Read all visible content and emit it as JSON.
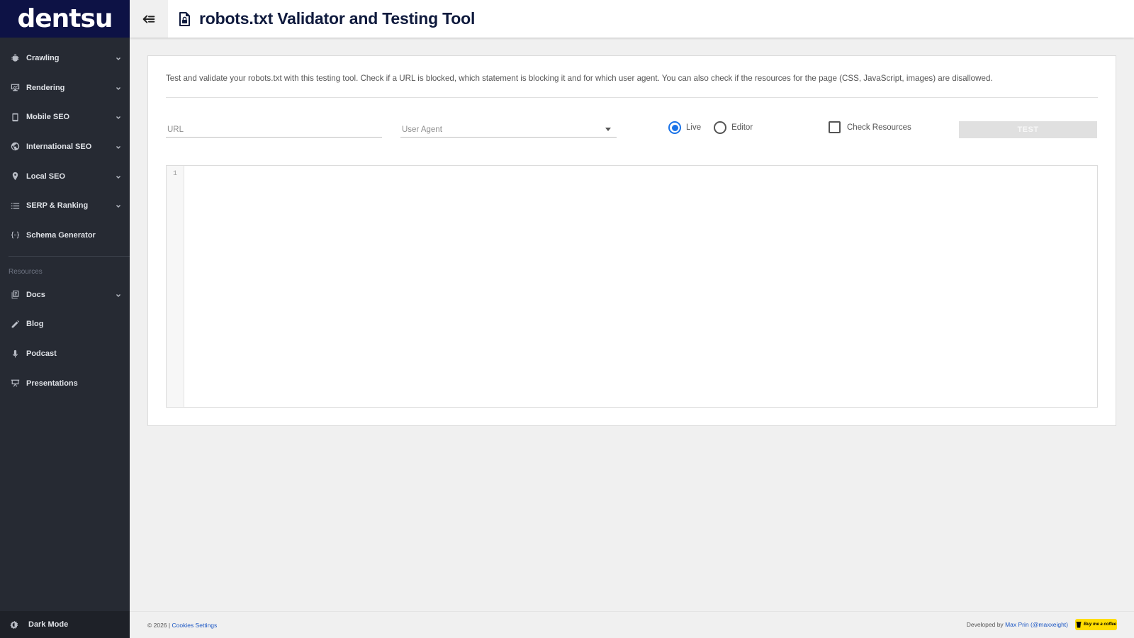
{
  "brand": {
    "logo_text": "dentsu"
  },
  "sidebar": {
    "items": [
      {
        "label": "Crawling",
        "icon": "bug-icon",
        "expandable": true
      },
      {
        "label": "Rendering",
        "icon": "monitor-icon",
        "expandable": true
      },
      {
        "label": "Mobile SEO",
        "icon": "mobile-icon",
        "expandable": true
      },
      {
        "label": "International SEO",
        "icon": "globe-icon",
        "expandable": true
      },
      {
        "label": "Local SEO",
        "icon": "map-pin-icon",
        "expandable": true
      },
      {
        "label": "SERP & Ranking",
        "icon": "list-icon",
        "expandable": true
      },
      {
        "label": "Schema Generator",
        "icon": "braces-icon",
        "expandable": false
      }
    ],
    "resources_label": "Resources",
    "resources": [
      {
        "label": "Docs",
        "icon": "docs-icon",
        "expandable": true
      },
      {
        "label": "Blog",
        "icon": "pencil-icon",
        "expandable": false
      },
      {
        "label": "Podcast",
        "icon": "microphone-icon",
        "expandable": false
      },
      {
        "label": "Presentations",
        "icon": "presentation-icon",
        "expandable": false
      }
    ],
    "dark_mode_label": "Dark Mode"
  },
  "header": {
    "back_icon": "arrow-left-icon",
    "title_icon": "file-lock-icon",
    "title": "robots.txt Validator and Testing Tool"
  },
  "main": {
    "description": "Test and validate your robots.txt with this testing tool. Check if a URL is blocked, which statement is blocking it and for which user agent. You can also check if the resources for the page (CSS, JavaScript, images) are disallowed.",
    "url_placeholder": "URL",
    "user_agent_placeholder": "User Agent",
    "radio_live": "Live",
    "radio_editor": "Editor",
    "radio_selected": "Live",
    "check_resources_label": "Check Resources",
    "test_button": "TEST",
    "editor_line_number": "1"
  },
  "footer": {
    "copyright": "© 2026 |",
    "cookies_link": "Cookies Settings",
    "developed_by": "Developed by",
    "author_link": "Max Prin (@maxxeight)",
    "coffee_label": "Buy me a coffee"
  },
  "colors": {
    "sidebar_bg": "#262a33",
    "brand_bg": "#0d1245",
    "accent": "#1a73e8",
    "link": "#1a56c4",
    "coffee_yellow": "#ffdd00"
  }
}
